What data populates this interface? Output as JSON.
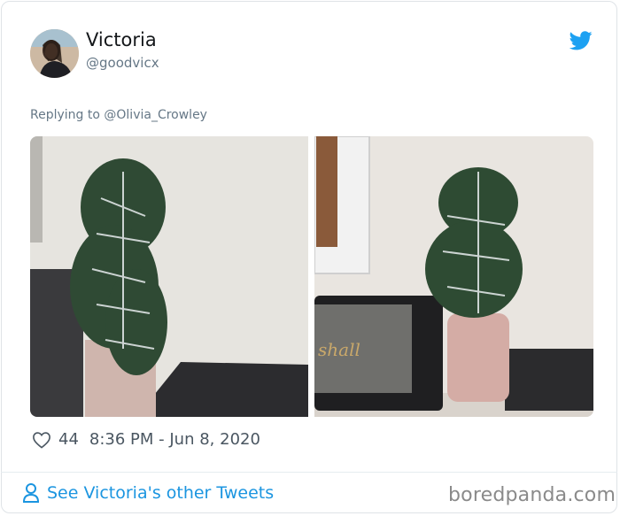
{
  "tweet": {
    "author_name": "Victoria",
    "author_handle": "@goodvicx",
    "reply_prefix": "Replying to ",
    "reply_to": "@Olivia_Crowley",
    "likes": "44",
    "timestamp": "8:36 PM - Jun 8, 2020",
    "brand_icon": "twitter-bird-icon",
    "brand_color": "#1da1f2"
  },
  "footer": {
    "link_label": "See Victoria's other Tweets",
    "link_color": "#1b95e0"
  },
  "watermark": "boredpanda.com"
}
